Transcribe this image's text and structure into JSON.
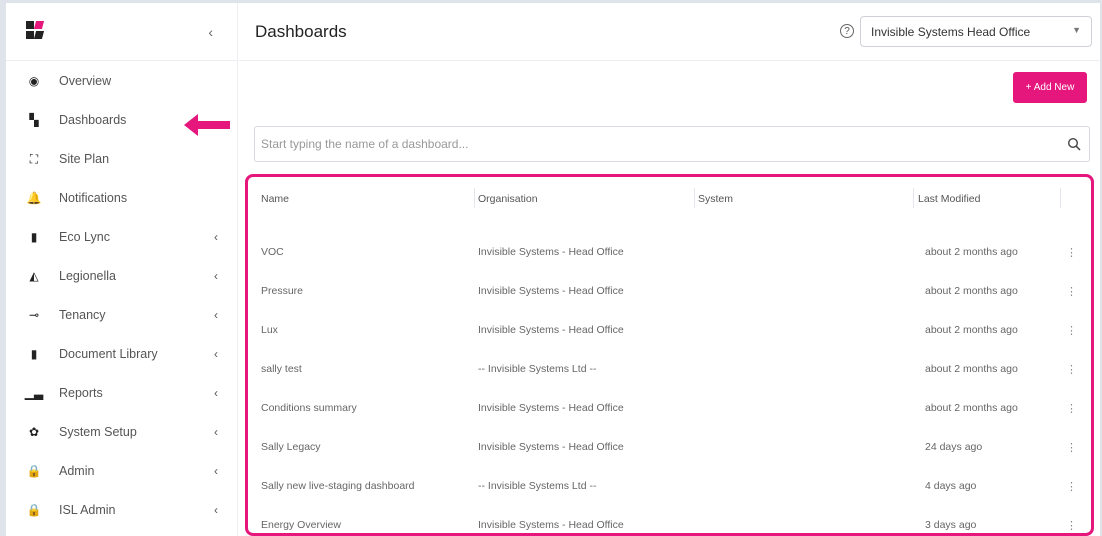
{
  "colors": {
    "accent": "#e5177d",
    "logo_pink": "#e5177d",
    "logo_dark": "#222222"
  },
  "sidebar": {
    "collapse_icon": "chevron-left-icon",
    "items": [
      {
        "label": "Overview",
        "icon": "eye-icon",
        "glyph": "◉",
        "chevron": ""
      },
      {
        "label": "Dashboards",
        "icon": "dashboard-icon",
        "glyph": "▚",
        "chevron": ""
      },
      {
        "label": "Site Plan",
        "icon": "site-plan-icon",
        "glyph": "⛶",
        "chevron": ""
      },
      {
        "label": "Notifications",
        "icon": "bell-icon",
        "glyph": "🔔",
        "chevron": ""
      },
      {
        "label": "Eco Lync",
        "icon": "file-icon",
        "glyph": "▮",
        "chevron": "‹"
      },
      {
        "label": "Legionella",
        "icon": "droplet-icon",
        "glyph": "◭",
        "chevron": "‹"
      },
      {
        "label": "Tenancy",
        "icon": "key-icon",
        "glyph": "⊸",
        "chevron": "‹"
      },
      {
        "label": "Document Library",
        "icon": "document-icon",
        "glyph": "▮",
        "chevron": "‹"
      },
      {
        "label": "Reports",
        "icon": "bar-chart-icon",
        "glyph": "▁▃",
        "chevron": "‹"
      },
      {
        "label": "System Setup",
        "icon": "gear-icon",
        "glyph": "✿",
        "chevron": "‹"
      },
      {
        "label": "Admin",
        "icon": "lock-icon",
        "glyph": "🔒",
        "chevron": "‹"
      },
      {
        "label": "ISL Admin",
        "icon": "lock-icon",
        "glyph": "🔒",
        "chevron": "‹"
      }
    ]
  },
  "header": {
    "title": "Dashboards",
    "help_glyph": "?",
    "org_select_value": "Invisible Systems Head Office"
  },
  "toolbar": {
    "add_label": "+ Add New"
  },
  "search": {
    "placeholder": "Start typing the name of a dashboard..."
  },
  "table": {
    "headers": [
      "Name",
      "Organisation",
      "System",
      "Last Modified"
    ],
    "rows": [
      {
        "name": "VOC",
        "organisation": "Invisible Systems - Head Office",
        "system": "",
        "modified": "about 2 months ago"
      },
      {
        "name": "Pressure",
        "organisation": "Invisible Systems - Head Office",
        "system": "",
        "modified": "about 2 months ago"
      },
      {
        "name": "Lux",
        "organisation": "Invisible Systems - Head Office",
        "system": "",
        "modified": "about 2 months ago"
      },
      {
        "name": "sally test",
        "organisation": "-- Invisible Systems Ltd --",
        "system": "",
        "modified": "about 2 months ago"
      },
      {
        "name": "Conditions summary",
        "organisation": "Invisible Systems - Head Office",
        "system": "",
        "modified": "about 2 months ago"
      },
      {
        "name": "Sally Legacy",
        "organisation": "Invisible Systems - Head Office",
        "system": "",
        "modified": "24 days ago"
      },
      {
        "name": "Sally new live-staging dashboard",
        "organisation": "-- Invisible Systems Ltd --",
        "system": "",
        "modified": "4 days ago"
      },
      {
        "name": "Energy Overview",
        "organisation": "Invisible Systems - Head Office",
        "system": "",
        "modified": "3 days ago"
      }
    ],
    "row_menu_glyph": "⋮"
  }
}
